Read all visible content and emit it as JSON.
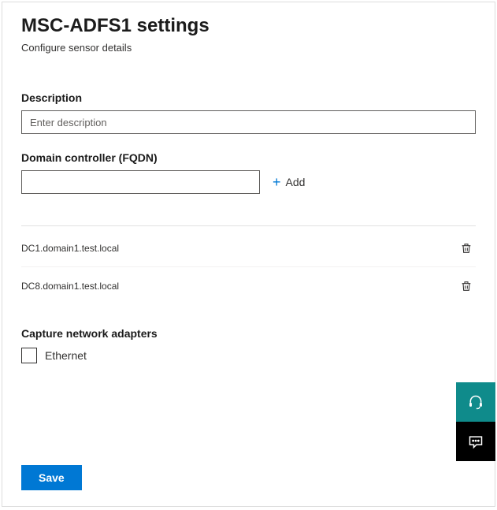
{
  "title": "MSC-ADFS1 settings",
  "subtitle": "Configure sensor details",
  "description": {
    "label": "Description",
    "placeholder": "Enter description",
    "value": ""
  },
  "domainController": {
    "label": "Domain controller (FQDN)",
    "value": "",
    "addLabel": "Add"
  },
  "dcList": [
    {
      "name": "DC1.domain1.test.local"
    },
    {
      "name": "DC8.domain1.test.local"
    }
  ],
  "adapters": {
    "label": "Capture network adapters",
    "items": [
      {
        "label": "Ethernet",
        "checked": false
      }
    ]
  },
  "saveLabel": "Save"
}
